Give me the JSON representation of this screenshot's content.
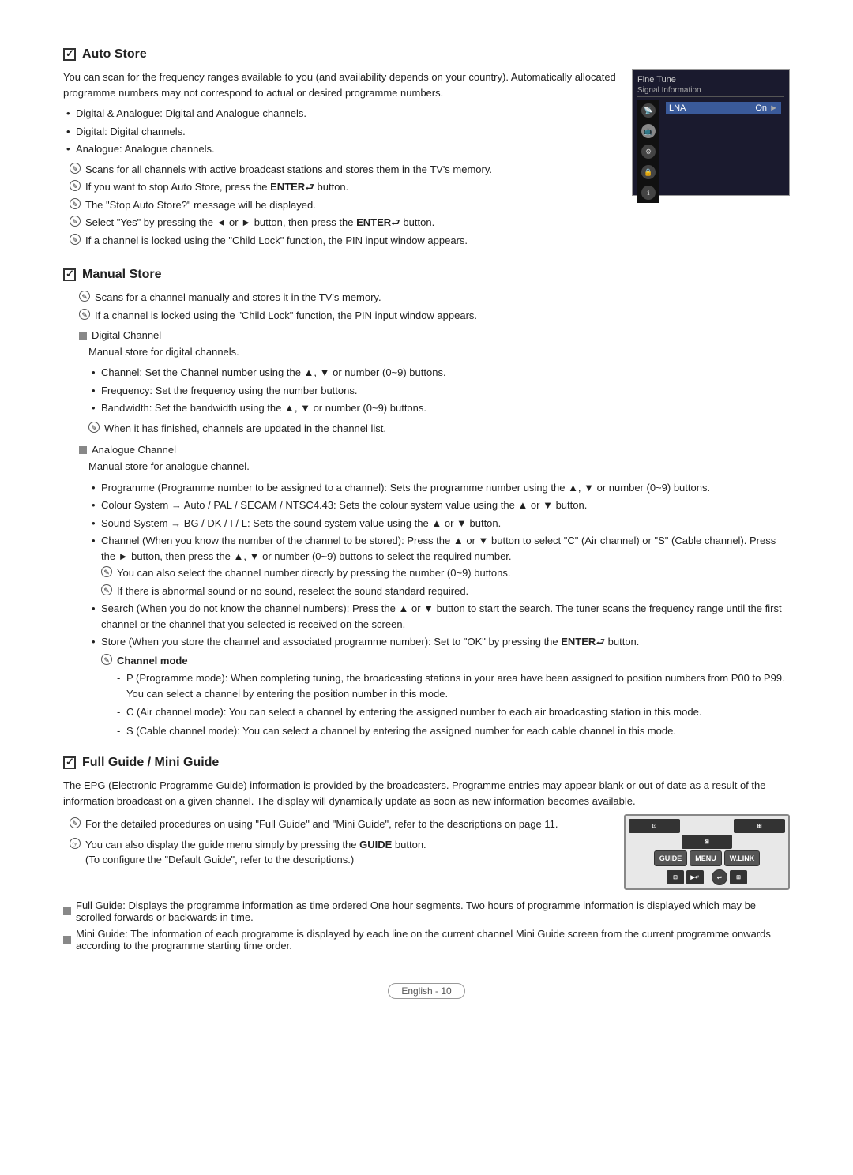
{
  "sections": {
    "auto_store": {
      "title": "Auto Store",
      "intro": "You can scan for the frequency ranges available to you (and availability depends on your country). Automatically allocated programme numbers may not correspond to actual or desired programme numbers.",
      "bullets": [
        "Digital & Analogue: Digital and Analogue channels.",
        "Digital: Digital channels.",
        "Analogue: Analogue channels."
      ],
      "notes": [
        "Scans for all channels with active broadcast stations and stores them in the TV's memory.",
        "If you want to stop Auto Store, press the ENTER button.",
        "The \"Stop Auto Store?\" message will be displayed.",
        "Select \"Yes\" by pressing the ◄ or ► button, then press the ENTER button.",
        "If a channel is locked using the \"Child Lock\" function, the PIN input window appears."
      ],
      "menu": {
        "title": "Fine Tune",
        "subtitle": "Signal Information",
        "row_label": "LNA",
        "row_value": "On"
      }
    },
    "manual_store": {
      "title": "Manual Store",
      "notes": [
        "Scans for a channel manually and stores it in the TV's memory.",
        "If a channel is locked using the \"Child Lock\" function, the PIN input window appears."
      ],
      "digital_channel": {
        "heading": "Digital Channel",
        "description": "Manual store for digital channels.",
        "bullets": [
          "Channel: Set the Channel number using the ▲, ▼ or number (0~9) buttons.",
          "Frequency: Set the frequency using the number buttons.",
          "Bandwidth: Set the bandwidth using the ▲, ▼ or number (0~9) buttons."
        ],
        "note": "When it has finished, channels are updated in the channel list."
      },
      "analogue_channel": {
        "heading": "Analogue Channel",
        "description": "Manual store for analogue channel.",
        "bullets": [
          "Programme (Programme number to be assigned to a channel): Sets the programme number using the ▲, ▼ or number (0~9) buttons.",
          "Colour System → Auto / PAL / SECAM / NTSC4.43: Sets the colour system value using the ▲ or ▼ button.",
          "Sound System → BG / DK / I / L: Sets the sound system value using the ▲ or ▼ button.",
          "Channel (When you know the number of the channel to be stored): Press the ▲ or ▼ button to select \"C\" (Air channel) or \"S\" (Cable channel). Press the ► button, then press the ▲, ▼ or number (0~9) buttons to select the required number.",
          "Search (When you do not know the channel numbers): Press the ▲ or ▼ button to start the search. The tuner scans the frequency range until the first channel or the channel that you selected is received on the screen.",
          "Store (When you store the channel and associated programme number): Set to \"OK\" by pressing the ENTER button."
        ],
        "channel_notes": [
          "You can also select the channel number directly by pressing the number (0~9) buttons.",
          "If there is abnormal sound or no sound, reselect the sound standard required."
        ],
        "channel_mode_label": "Channel mode",
        "channel_mode_items": [
          "P (Programme mode): When completing tuning, the broadcasting stations in your area have been assigned to position numbers from P00 to P99. You can select a channel by entering the position number in this mode.",
          "C (Air channel mode): You can select a channel by entering the assigned number to each air broadcasting station in this mode.",
          "S (Cable channel mode): You can select a channel by entering the assigned number for each cable channel in this mode."
        ]
      }
    },
    "full_guide": {
      "title": "Full Guide / Mini Guide",
      "intro": "The EPG (Electronic Programme Guide) information is provided by the broadcasters. Programme entries may appear blank or out of date as a result of the information broadcast on a given channel. The display will dynamically update as soon as new information becomes available.",
      "notes": [
        "For the detailed procedures on using \"Full Guide\" and \"Mini Guide\", refer to the descriptions on page 11.",
        "You can also display the guide menu simply by pressing the GUIDE button. (To configure the \"Default Guide\", refer to the descriptions.)"
      ],
      "full_guide_desc": "Full Guide: Displays the programme information as time ordered One hour segments. Two hours of programme information is displayed which may be scrolled forwards or backwards in time.",
      "mini_guide_desc": "Mini Guide: The information of each programme is displayed by each line on the current channel Mini Guide screen from the current programme onwards according to the programme starting time order."
    }
  },
  "footer": {
    "text": "English - 10"
  }
}
